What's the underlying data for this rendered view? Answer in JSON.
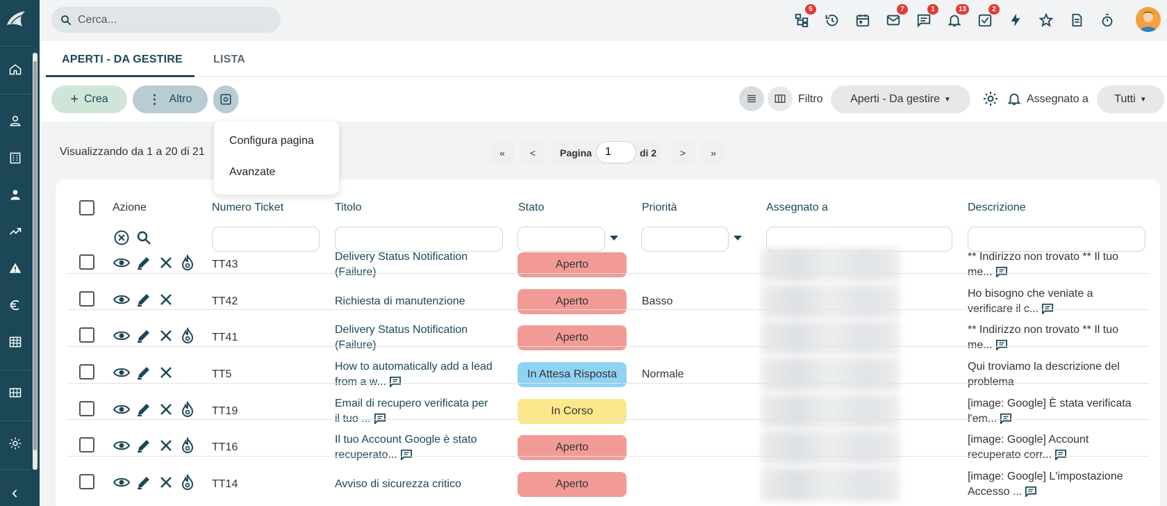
{
  "search": {
    "placeholder": "Cerca..."
  },
  "topbar": {
    "icons": [
      {
        "name": "sitemap-icon",
        "badge": "5"
      },
      {
        "name": "history-icon",
        "badge": ""
      },
      {
        "name": "calendar-icon",
        "badge": ""
      },
      {
        "name": "mail-icon",
        "badge": "7"
      },
      {
        "name": "chat-icon",
        "badge": "1"
      },
      {
        "name": "bell-icon",
        "badge": "13"
      },
      {
        "name": "tasks-icon",
        "badge": "2"
      },
      {
        "name": "bolt-icon",
        "badge": ""
      },
      {
        "name": "star-icon",
        "badge": ""
      },
      {
        "name": "document-icon",
        "badge": ""
      },
      {
        "name": "timer-icon",
        "badge": ""
      }
    ]
  },
  "tabs": [
    {
      "label": "APERTI - DA GESTIRE",
      "active": true
    },
    {
      "label": "LISTA",
      "active": false
    }
  ],
  "toolbar": {
    "create_label": "Crea",
    "more_label": "Altro",
    "filter_label": "Filtro",
    "filter_value": "Aperti - Da gestire",
    "assigned_label": "Assegnato a",
    "assigned_value": "Tutti"
  },
  "dropdown": {
    "items": [
      "Configura pagina",
      "Avanzate"
    ]
  },
  "pagination": {
    "showing": "Visualizzando da 1 a 20 di 21",
    "first": "«",
    "prev": "<",
    "page_label": "Pagina",
    "page_value": "1",
    "of_label": "di 2",
    "next": ">",
    "last": "»"
  },
  "table": {
    "headers": {
      "action": "Azione",
      "ticket": "Numero Ticket",
      "title": "Titolo",
      "status": "Stato",
      "priority": "Priorità",
      "assigned": "Assegnato a",
      "description": "Descrizione"
    },
    "rows": [
      {
        "ticket": "TT43",
        "title1": "Delivery Status Notification",
        "title2": "(Failure)",
        "title_msg": false,
        "status": "Aperto",
        "priority": "",
        "desc1": "** Indirizzo non trovato ** Il tuo",
        "desc2": "me...",
        "desc_msg": true,
        "fire": true
      },
      {
        "ticket": "TT42",
        "title1": "Richiesta di manutenzione",
        "title2": "",
        "title_msg": false,
        "status": "Aperto",
        "priority": "Basso",
        "desc1": "Ho bisogno che veniate a",
        "desc2": "verificare il c...",
        "desc_msg": true,
        "fire": false
      },
      {
        "ticket": "TT41",
        "title1": "Delivery Status Notification",
        "title2": "(Failure)",
        "title_msg": false,
        "status": "Aperto",
        "priority": "",
        "desc1": "** Indirizzo non trovato ** Il tuo",
        "desc2": "me...",
        "desc_msg": true,
        "fire": true
      },
      {
        "ticket": "TT5",
        "title1": "How to automatically add a lead",
        "title2": "from a w...",
        "title_msg": true,
        "status": "In Attesa Risposta",
        "priority": "Normale",
        "desc1": "Qui troviamo la descrizione del",
        "desc2": "problema",
        "desc_msg": false,
        "fire": false
      },
      {
        "ticket": "TT19",
        "title1": "Email di recupero verificata per",
        "title2": "il tuo ...",
        "title_msg": true,
        "status": "In Corso",
        "priority": "",
        "desc1": "[image: Google] È stata verificata",
        "desc2": "l'em...",
        "desc_msg": true,
        "fire": true
      },
      {
        "ticket": "TT16",
        "title1": "Il tuo Account Google è stato",
        "title2": "recuperato...",
        "title_msg": true,
        "status": "Aperto",
        "priority": "",
        "desc1": "[image: Google] Account",
        "desc2": "recuperato corr...",
        "desc_msg": true,
        "fire": true
      },
      {
        "ticket": "TT14",
        "title1": "Avviso di sicurezza critico",
        "title2": "",
        "title_msg": false,
        "status": "Aperto",
        "priority": "",
        "desc1": "[image: Google] L'impostazione",
        "desc2": "Accesso ...",
        "desc_msg": true,
        "fire": true
      }
    ]
  },
  "colors": {
    "sidebar": "#1b4757",
    "status_open": "#f29b96",
    "status_waiting": "#8fd3f4",
    "status_progress": "#fce88c"
  }
}
